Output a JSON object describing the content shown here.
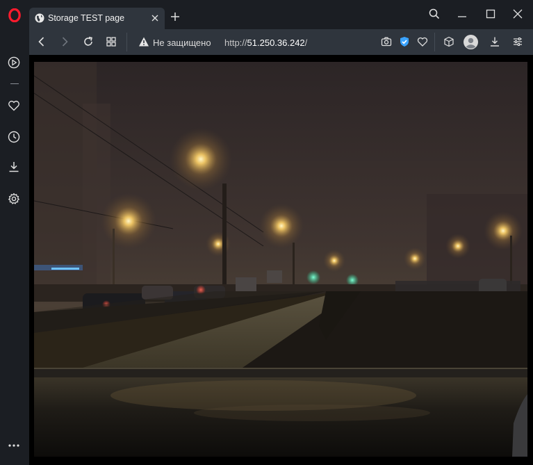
{
  "tab": {
    "title": "Storage TEST page",
    "favicon": "globe-icon"
  },
  "address_bar": {
    "security_label": "Не защищено",
    "url_scheme": "http://",
    "url_host": "51.250.36.242",
    "url_path": "/"
  },
  "sidebar": {
    "items": [
      "player-icon",
      "heart-icon",
      "history-icon",
      "downloads-icon",
      "settings-icon",
      "more-icon"
    ]
  },
  "colors": {
    "opera_red": "#ff1b2d",
    "vpn_blue": "#3aa3ff",
    "chrome_dark": "#1b1e23",
    "toolbar": "#2f353d"
  },
  "page": {
    "content": "night-foggy-street-photo"
  }
}
